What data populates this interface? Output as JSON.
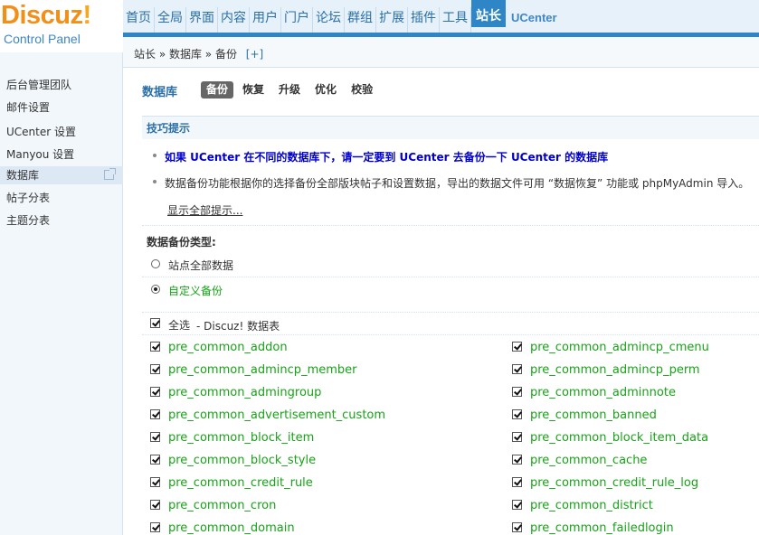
{
  "logo": {
    "main_a": "Discuz",
    "main_b": "!",
    "sub": "Control Panel"
  },
  "topnav": [
    {
      "label": "首页"
    },
    {
      "label": "全局"
    },
    {
      "label": "界面"
    },
    {
      "label": "内容"
    },
    {
      "label": "用户"
    },
    {
      "label": "门户"
    },
    {
      "label": "论坛"
    },
    {
      "label": "群组"
    },
    {
      "label": "扩展"
    },
    {
      "label": "插件"
    },
    {
      "label": "工具"
    },
    {
      "label": "站长",
      "active": true
    },
    {
      "label": "UCenter"
    }
  ],
  "breadcrumb": {
    "text": "站长 » 数据库 » 备份",
    "add": "[+]"
  },
  "sidebar": {
    "items": [
      {
        "label": "后台管理团队"
      },
      {
        "label": "邮件设置"
      },
      {
        "label": "UCenter 设置"
      },
      {
        "label": "Manyou 设置"
      },
      {
        "label": "数据库",
        "active": true
      },
      {
        "label": "帖子分表"
      },
      {
        "label": "主题分表"
      }
    ]
  },
  "page": {
    "title": "数据库",
    "tabs": [
      {
        "label": "备份",
        "active": true
      },
      {
        "label": "恢复"
      },
      {
        "label": "升级"
      },
      {
        "label": "优化"
      },
      {
        "label": "校验"
      }
    ]
  },
  "tips": {
    "title": "技巧提示",
    "tip1": "如果 UCenter 在不同的数据库下，请一定要到 UCenter 去备份一下 UCenter 的数据库",
    "tip2": "数据备份功能根据你的选择备份全部版块帖子和设置数据，导出的数据文件可用 “数据恢复” 功能或 phpMyAdmin 导入。",
    "show_all": "显示全部提示..."
  },
  "backup": {
    "type_label": "数据备份类型:",
    "option_all": "站点全部数据",
    "option_custom": "自定义备份",
    "select_all": "全选",
    "select_all_sub": "- Discuz! 数据表"
  },
  "tables": [
    "pre_common_addon",
    "pre_common_admincp_cmenu",
    "pre_common_admincp_member",
    "pre_common_admincp_perm",
    "pre_common_admingroup",
    "pre_common_adminnote",
    "pre_common_advertisement_custom",
    "pre_common_banned",
    "pre_common_block_item",
    "pre_common_block_item_data",
    "pre_common_block_style",
    "pre_common_cache",
    "pre_common_credit_rule",
    "pre_common_credit_rule_log",
    "pre_common_cron",
    "pre_common_district",
    "pre_common_domain",
    "pre_common_failedlogin"
  ],
  "colors": {
    "accent": "#2f86c6",
    "table_name": "#17a317",
    "tip_highlight": "#0000cc"
  }
}
